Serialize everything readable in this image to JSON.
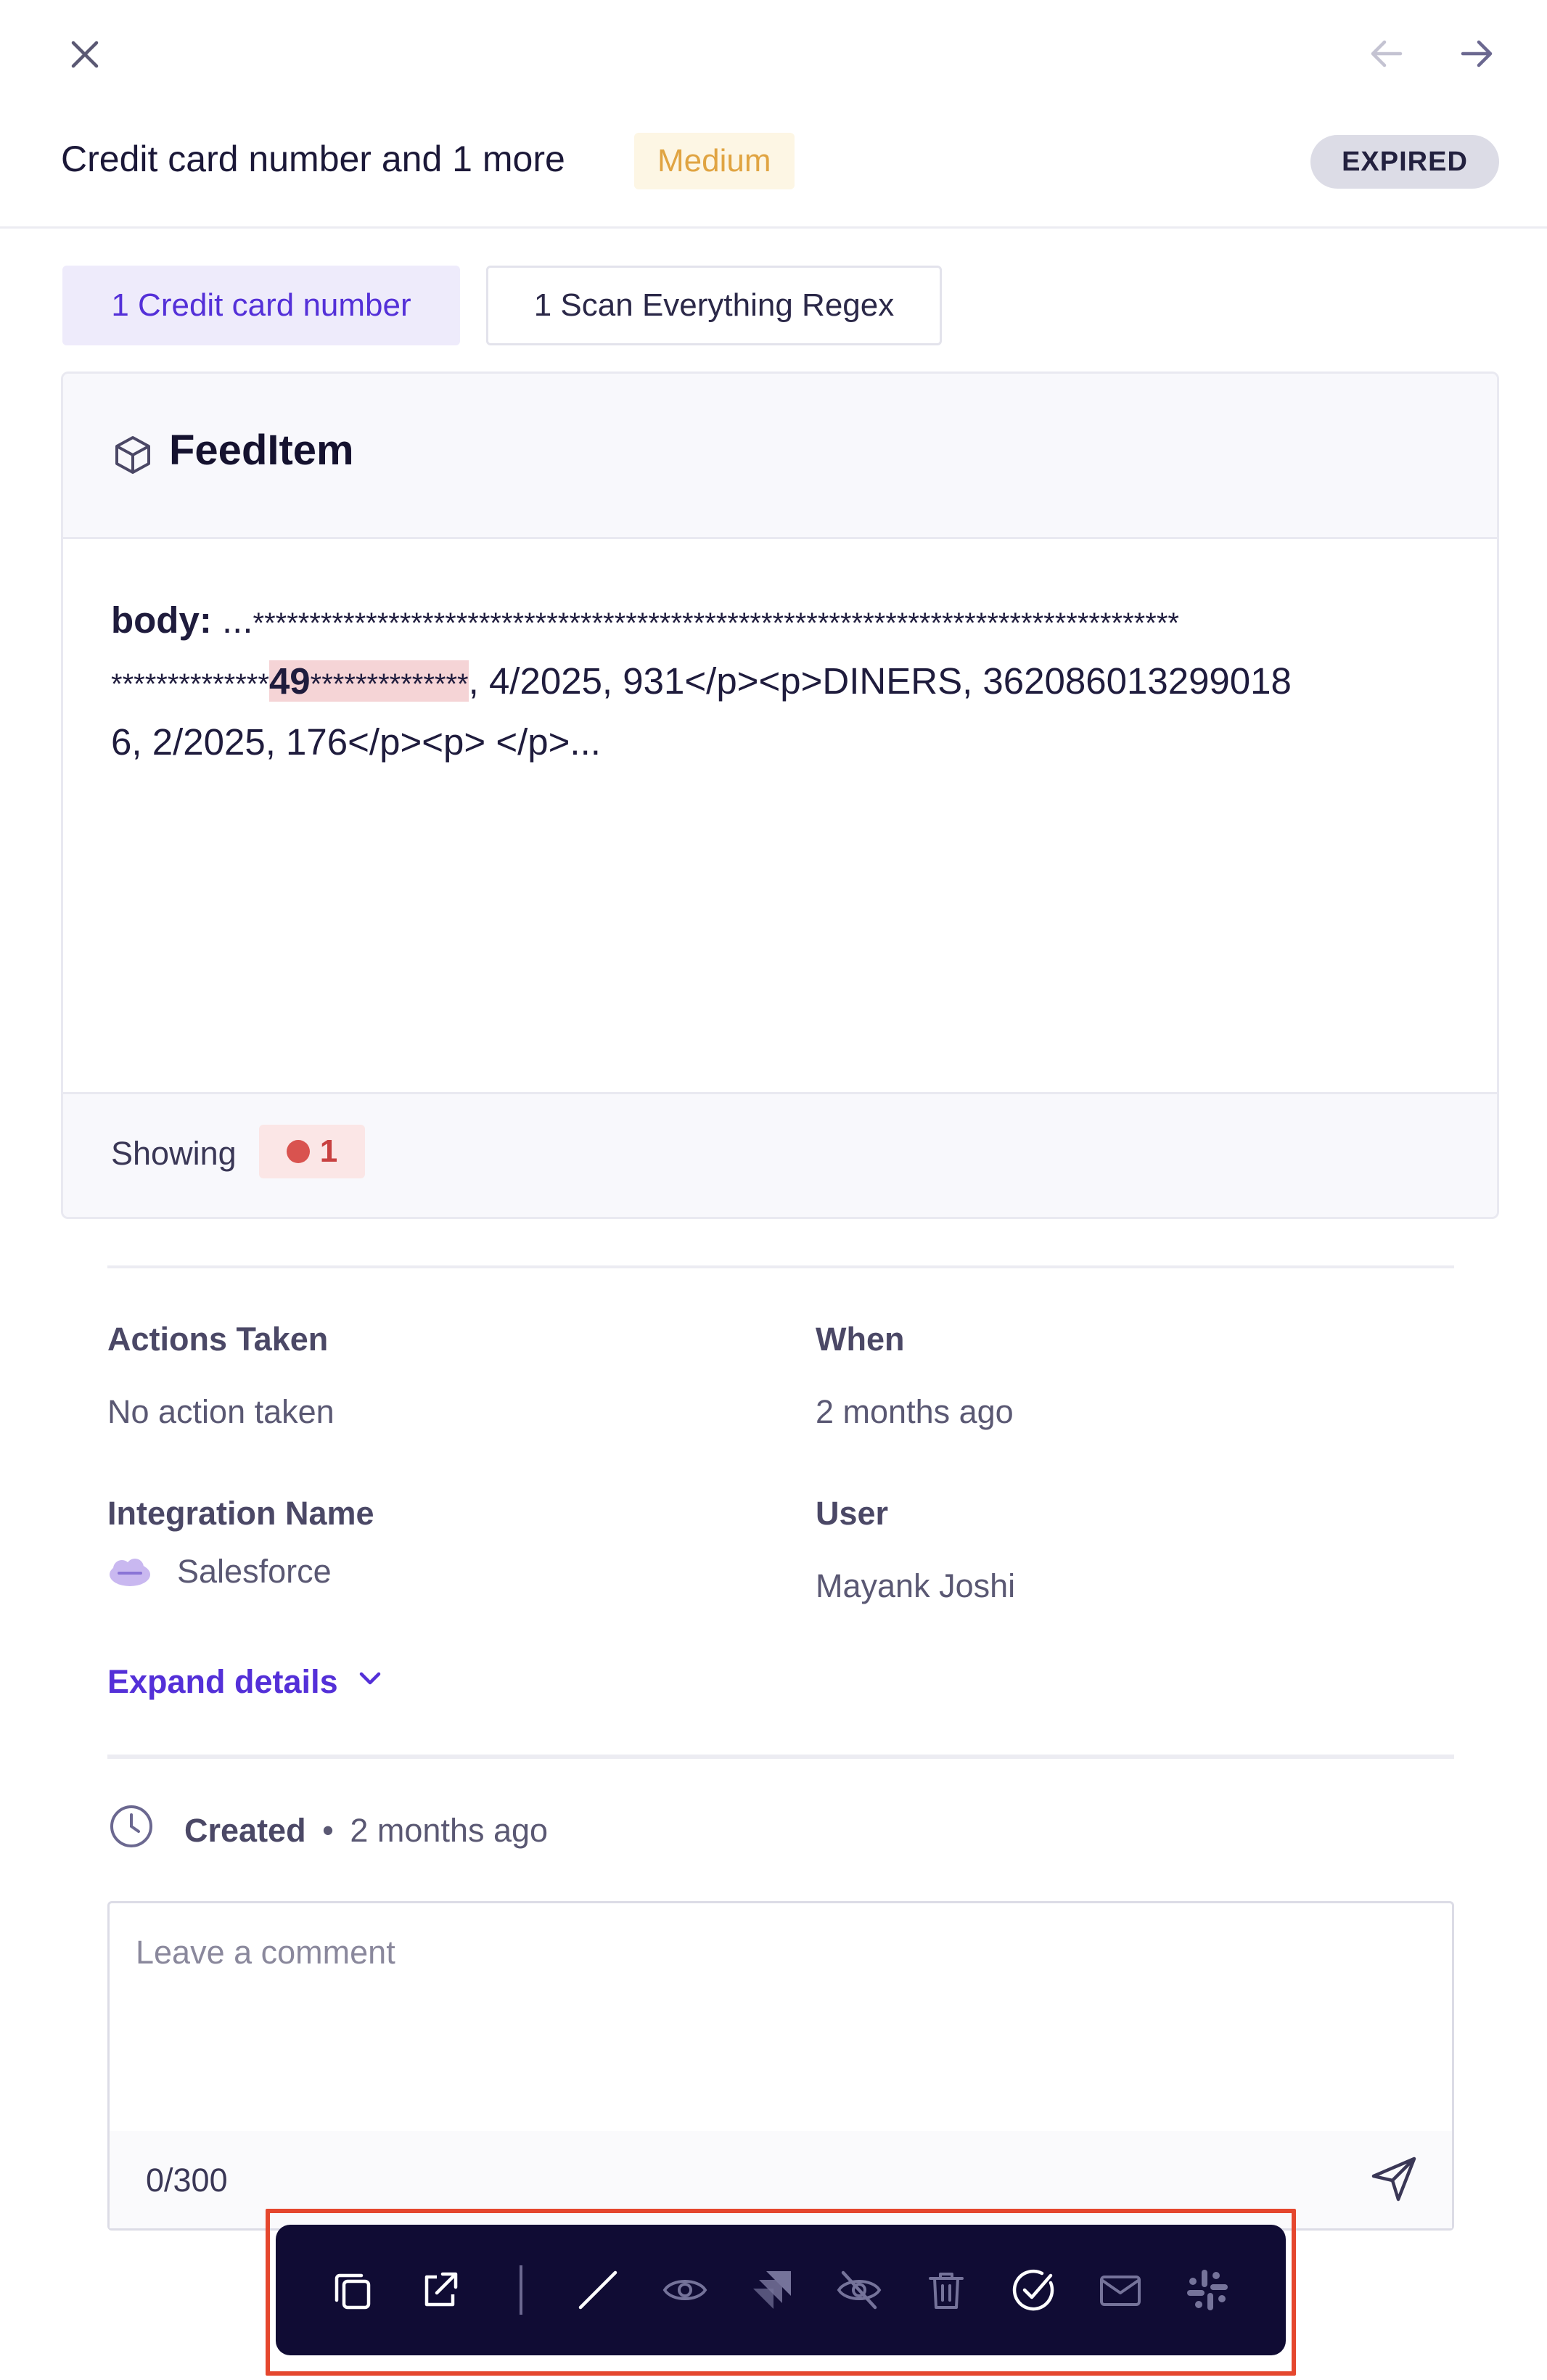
{
  "header": {
    "title": "Credit card number and 1 more",
    "severity": "Medium",
    "status": "EXPIRED"
  },
  "tabs": [
    {
      "label": "1 Credit card number",
      "active": true
    },
    {
      "label": "1 Scan Everything Regex",
      "active": false
    }
  ],
  "card": {
    "title": "FeedItem",
    "icon": "cube-icon",
    "body_field": "body:",
    "body_prefix": " ...",
    "stars_line1": "**********************************************************************************",
    "stars_line2_pre": "**************",
    "highlight_digits": "49",
    "highlight_stars": "**************",
    "body_rest_line2": ", 4/2025, 931</p><p>DINERS, 362086013299018",
    "body_line3": "6, 2/2025, 176</p><p> </p>...",
    "showing_label": "Showing",
    "showing_count": "1"
  },
  "details": {
    "actions_label": "Actions Taken",
    "actions_value": "No action taken",
    "when_label": "When",
    "when_value": "2 months ago",
    "integration_label": "Integration Name",
    "integration_value": "Salesforce",
    "user_label": "User",
    "user_value": "Mayank Joshi",
    "expand_label": "Expand details"
  },
  "activity": {
    "created_label": "Created",
    "created_sep": "•",
    "created_time": "2 months ago"
  },
  "comment": {
    "placeholder": "Leave a comment",
    "counter": "0/300"
  },
  "toolbar_icons": [
    "copy-icon",
    "external-link-icon",
    "slash-icon",
    "eye-icon",
    "jira-icon",
    "eye-off-icon",
    "trash-icon",
    "check-circle-icon",
    "mail-icon",
    "slack-icon"
  ],
  "colors": {
    "accent": "#5430d8",
    "severity_medium": "#e0a442",
    "toolbar_bg": "#100c34",
    "highlight_frame": "#e5472e",
    "match_bg": "#f5d4d6"
  }
}
